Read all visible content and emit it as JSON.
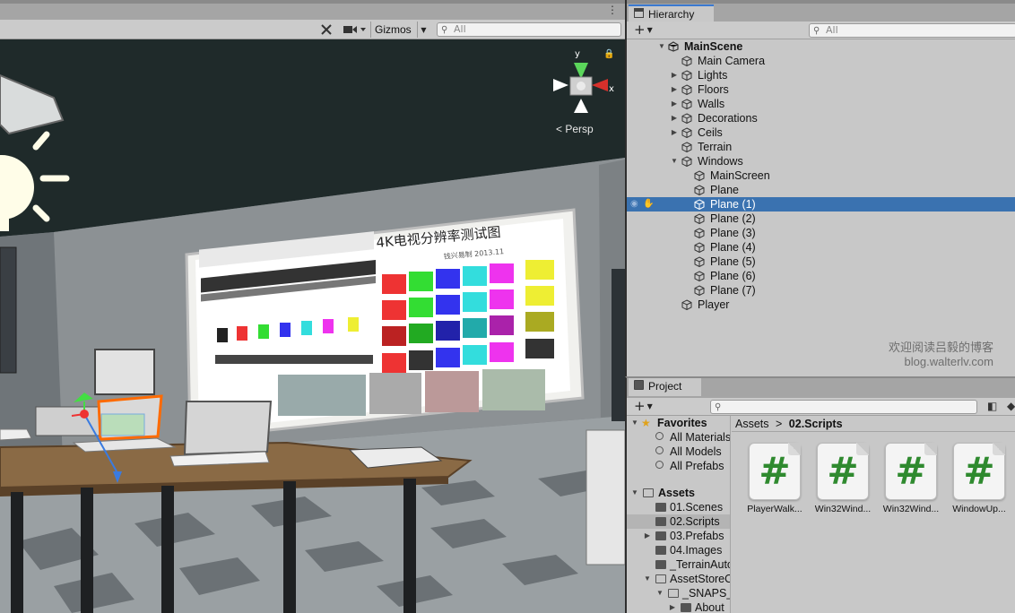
{
  "scene_view": {
    "gizmos_label": "Gizmos",
    "search_placeholder": "All",
    "persp_label": "< Persp",
    "axis_y": "y",
    "axis_x": "x"
  },
  "hierarchy": {
    "tab_label": "Hierarchy",
    "search_placeholder": "All",
    "items": [
      {
        "label": "MainScene"
      },
      {
        "label": "Main Camera"
      },
      {
        "label": "Lights"
      },
      {
        "label": "Floors"
      },
      {
        "label": "Walls"
      },
      {
        "label": "Decorations"
      },
      {
        "label": "Ceils"
      },
      {
        "label": "Terrain"
      },
      {
        "label": "Windows"
      },
      {
        "label": "MainScreen"
      },
      {
        "label": "Plane"
      },
      {
        "label": "Plane (1)"
      },
      {
        "label": "Plane (2)"
      },
      {
        "label": "Plane (3)"
      },
      {
        "label": "Plane (4)"
      },
      {
        "label": "Plane (5)"
      },
      {
        "label": "Plane (6)"
      },
      {
        "label": "Plane (7)"
      },
      {
        "label": "Player"
      }
    ],
    "watermark_line1": "欢迎阅读吕毅的博客",
    "watermark_line2": "blog.walterlv.com"
  },
  "project": {
    "tab_label": "Project",
    "tree": [
      {
        "label": "Favorites"
      },
      {
        "label": "All Materials"
      },
      {
        "label": "All Models"
      },
      {
        "label": "All Prefabs"
      },
      {
        "label": "Assets"
      },
      {
        "label": "01.Scenes"
      },
      {
        "label": "02.Scripts"
      },
      {
        "label": "03.Prefabs"
      },
      {
        "label": "04.Images"
      },
      {
        "label": "_TerrainAuto"
      },
      {
        "label": "AssetStoreO"
      },
      {
        "label": "_SNAPS_"
      },
      {
        "label": "About"
      }
    ],
    "breadcrumb_root": "Assets",
    "breadcrumb_sep": ">",
    "breadcrumb_current": "02.Scripts",
    "assets": [
      {
        "name": "PlayerWalk...",
        "glyph": "#"
      },
      {
        "name": "Win32Wind...",
        "glyph": "#"
      },
      {
        "name": "Win32Wind...",
        "glyph": "#"
      },
      {
        "name": "WindowUp...",
        "glyph": "#"
      }
    ]
  },
  "poster": {
    "title": "4K电视分辨率测试图",
    "author": "钱兴易制 2013.11"
  },
  "colors": {
    "selection": "#3a72b0",
    "tab_accent": "#3a79d1",
    "script_icon_green": "#2f8a2f"
  }
}
